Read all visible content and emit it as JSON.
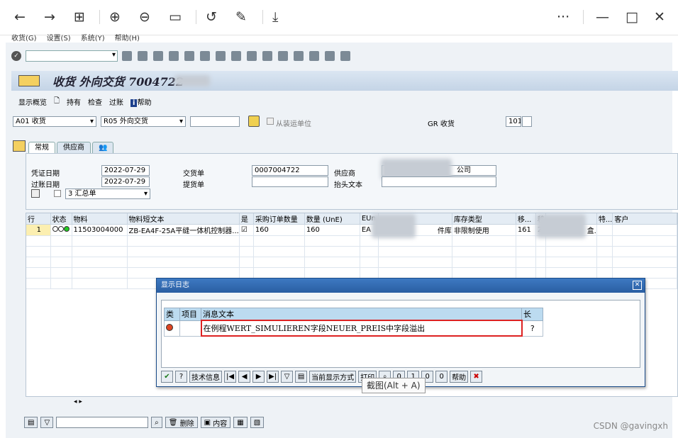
{
  "browser_toolbar": {
    "back_icon": "←",
    "forward_icon": "→",
    "grid_icon": "⊞",
    "zoom_in_icon": "⊕",
    "zoom_out_icon": "⊖",
    "fit_icon": "▭",
    "rotate_icon": "↺",
    "edit_icon": "✎",
    "download_icon": "⤓",
    "more_icon": "···",
    "minimize_icon": "—",
    "maximize_icon": "□",
    "close_icon": "✕"
  },
  "menu": [
    "收货(G)",
    "设置(S)",
    "系统(Y)",
    "帮助(H)"
  ],
  "title": "收货 外向交货 7004722",
  "app_toolbar": [
    "显示概览",
    "持有",
    "检查",
    "过账",
    "帮助"
  ],
  "header": {
    "action_select": "A01 收货",
    "ref_select": "R05 外向交货",
    "from_unit_label": "从装运单位",
    "gr_label": "GR 收货",
    "gr_value": "101"
  },
  "tabs": [
    "常规",
    "供应商"
  ],
  "general": {
    "doc_date_label": "凭证日期",
    "doc_date": "2022-07-29",
    "post_date_label": "过账日期",
    "post_date": "2022-07-29",
    "delivery_label": "交货单",
    "delivery_value": "0007004722",
    "bill_label": "提货单",
    "vendor_label": "供应商",
    "vendor_value_suffix": "公司",
    "header_text_label": "抬头文本",
    "slip_value": "3 汇总单"
  },
  "grid": {
    "columns": [
      "行",
      "状态",
      "物料",
      "物料短文本",
      "是",
      "采购订单数量",
      "数量 (UnE)",
      "EUn",
      "",
      "库存类型",
      "移...",
      "移",
      "",
      "特...",
      "客户"
    ],
    "rows": [
      [
        "1",
        "",
        "11503004000",
        "ZB-EA4F-25A平缝一体机控制器...",
        "☑",
        "160",
        "160",
        "EA",
        "",
        "非限制使用",
        "161",
        "2",
        "",
        "",
        ""
      ]
    ],
    "row_partial_text": "件库",
    "row_partial_text2": "盒."
  },
  "dialog": {
    "title": "显示日志",
    "columns": [
      "类",
      "项目",
      "消息文本",
      "长"
    ],
    "message": "在例程WERT_SIMULIEREN字段NEUER_PREIS中字段溢出",
    "toolbar": {
      "tech_info": "技术信息",
      "current_display": "当前显示方式",
      "print": "打印",
      "stop_count": "0",
      "error_count": "1",
      "warn_count": "0",
      "ok_count": "0",
      "help": "帮助"
    }
  },
  "tooltip": "截图(Alt + A)",
  "status": {
    "delete": "删除",
    "content": "内容"
  },
  "watermark": "CSDN @gavingxh"
}
